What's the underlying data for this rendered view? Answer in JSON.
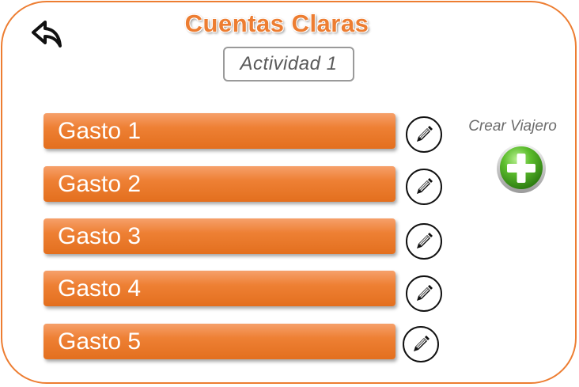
{
  "header": {
    "title": "Cuentas Claras",
    "activity_name": "Actividad 1"
  },
  "gastos": [
    {
      "label": "Gasto 1"
    },
    {
      "label": "Gasto 2"
    },
    {
      "label": "Gasto 3"
    },
    {
      "label": "Gasto 4"
    },
    {
      "label": "Gasto 5"
    }
  ],
  "sidebar": {
    "create_traveler_label": "Crear Viajero"
  },
  "icons": {
    "back": "back-arrow-icon",
    "edit": "pencil-icon",
    "add": "plus-icon"
  },
  "colors": {
    "accent": "#ED7D31",
    "add_button": "#5DBE2E"
  }
}
